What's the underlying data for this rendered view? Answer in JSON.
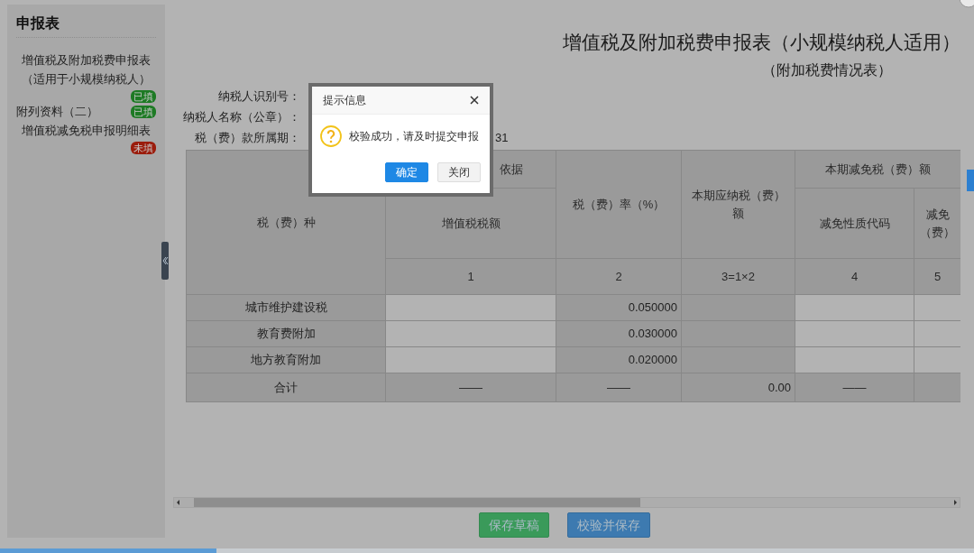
{
  "sidebar": {
    "title": "申报表",
    "items": [
      {
        "kind": "stacked",
        "lines": [
          "增值税及附加税费申报表",
          "（适用于小规模纳税人）"
        ],
        "badge": "已填",
        "color": "#1d7a24"
      },
      {
        "kind": "inline",
        "lines": [
          "附列资料（二）"
        ],
        "badge": "已填",
        "color": "#1d7a24"
      },
      {
        "kind": "stacked",
        "lines": [
          "增值税减免税申报明细表"
        ],
        "badge": "未填",
        "color": "#9b1c0c"
      }
    ]
  },
  "form": {
    "title": "增值税及附加税费申报表（小规模纳税人适用）",
    "subtitle": "（附加税费情况表）",
    "fields": [
      {
        "label": "纳税人识别号："
      },
      {
        "label": "纳税人名称（公章）："
      },
      {
        "label": "税（费）款所属期：",
        "value": "31"
      }
    ]
  },
  "table": {
    "tax_type": "税（费）种",
    "basis_group": "依据",
    "vat_amount": "增值税税额",
    "rate": "税（费）率（%）",
    "payable": "本期应纳税（费）额",
    "relief_group": "本期减免税（费）额",
    "relief_code": "减免性质代码",
    "relief_amount": [
      "减免",
      "（费）"
    ],
    "numbers": [
      "1",
      "2",
      "3=1×2",
      "4",
      "5"
    ],
    "rows": [
      {
        "name": "城市维护建设税",
        "rate": "0.050000"
      },
      {
        "name": "教育费附加",
        "rate": "0.030000"
      },
      {
        "name": "地方教育附加",
        "rate": "0.020000"
      }
    ],
    "total": {
      "label": "合计",
      "vat_amount": "——",
      "rate": "——",
      "payable": "0.00",
      "relief_code": "——"
    }
  },
  "buttons": [
    {
      "label": "保存草稿",
      "kind": "success"
    },
    {
      "label": "校验并保存",
      "kind": "primary"
    }
  ],
  "dialog": {
    "title": "提示信息",
    "message": "校验成功，请及时提交申报",
    "buttons": [
      {
        "label": "确定",
        "kind": "primary"
      },
      {
        "label": "关闭",
        "kind": "default"
      }
    ]
  }
}
